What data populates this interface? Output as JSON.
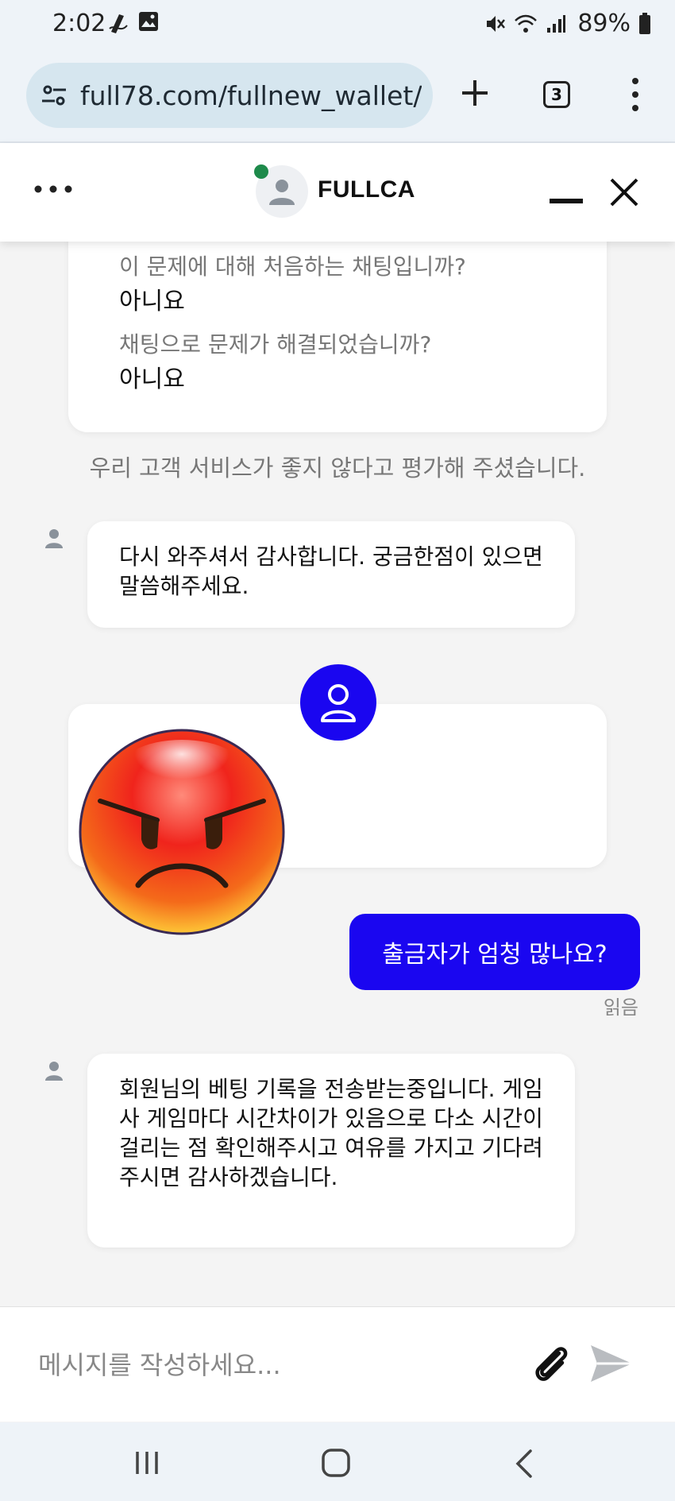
{
  "status_bar": {
    "time": "2:02",
    "battery": "89%"
  },
  "browser": {
    "url": "full78.com/fullnew_wallet/",
    "tab_count": "3"
  },
  "chat_header": {
    "title": "FULLCA"
  },
  "survey": {
    "q1": "이 문제에 대해 처음하는 채팅입니까?",
    "a1": "아니요",
    "q2": "채팅으로 문제가 해결되었습니까?",
    "a2": "아니요"
  },
  "rating_note": "우리 고객 서비스가 좋지 않다고 평가해 주셨습니다.",
  "messages": {
    "agent_1": "다시 와주셔서 감사합니다. 궁금한점이 있으면말씀해주세요.",
    "user_1": "출금자가 엄청 많나요?",
    "user_1_status": "읽음",
    "agent_2": "회원님의 베팅 기록을 전송받는중입니다. 게임사 게임마다 시간차이가 있음으로 다소 시간이 걸리는 점 확인해주시고 여유를 가지고 기다려 주시면 감사하겠습니다."
  },
  "composer": {
    "placeholder": "메시지를 작성하세요..."
  },
  "colors": {
    "accent": "#1a06f0",
    "online": "#1e8a4b"
  }
}
